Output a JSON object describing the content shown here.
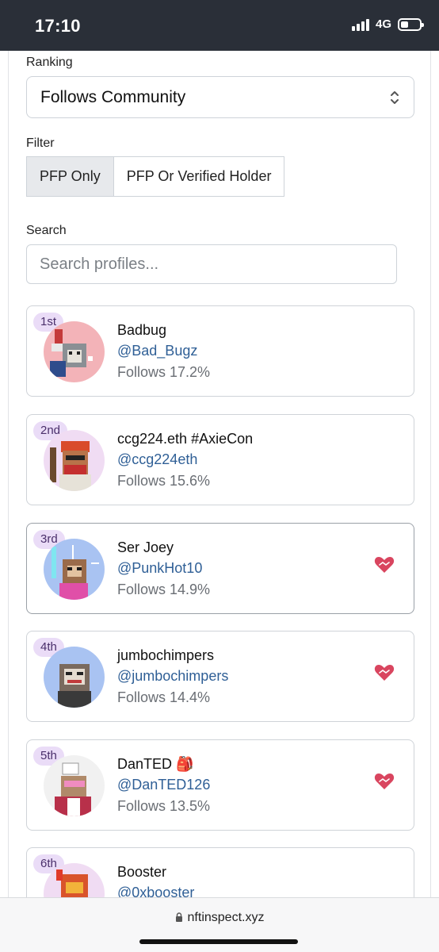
{
  "status_bar": {
    "time": "17:10",
    "network": "4G",
    "battery_level": 0.4
  },
  "ranking": {
    "label": "Ranking",
    "selected": "Follows Community"
  },
  "filter": {
    "label": "Filter",
    "options": [
      "PFP Only",
      "PFP Or Verified Holder"
    ],
    "selected": "PFP Only"
  },
  "search": {
    "label": "Search",
    "placeholder": "Search profiles...",
    "value": ""
  },
  "profiles": [
    {
      "rank": "1st",
      "name": "Badbug",
      "handle": "@Bad_Bugz",
      "follows": "Follows 17.2%",
      "heart": false,
      "avatar_bg": "#f3b3b8"
    },
    {
      "rank": "2nd",
      "name": "ccg224.eth #AxieCon",
      "handle": "@ccg224eth",
      "follows": "Follows 15.6%",
      "heart": false,
      "avatar_bg": "#f0dcf3"
    },
    {
      "rank": "3rd",
      "name": "Ser Joey",
      "handle": "@PunkHot10",
      "follows": "Follows 14.9%",
      "heart": true,
      "avatar_bg": "#a9c3f2"
    },
    {
      "rank": "4th",
      "name": "jumbochimpers",
      "handle": "@jumbochimpers",
      "follows": "Follows 14.4%",
      "heart": true,
      "avatar_bg": "#a9c3f2"
    },
    {
      "rank": "5th",
      "name": "DanTED 🎒",
      "handle": "@DanTED126",
      "follows": "Follows 13.5%",
      "heart": true,
      "avatar_bg": "#f1f1f1"
    },
    {
      "rank": "6th",
      "name": "Booster",
      "handle": "@0xbooster",
      "follows": "",
      "heart": false,
      "avatar_bg": "#f0dcf3"
    }
  ],
  "bottom_bar": {
    "url": "nftinspect.xyz"
  },
  "colors": {
    "accent_link": "#2f5f96",
    "rank_badge": "#eadcf7",
    "heart": "#d9455f"
  }
}
